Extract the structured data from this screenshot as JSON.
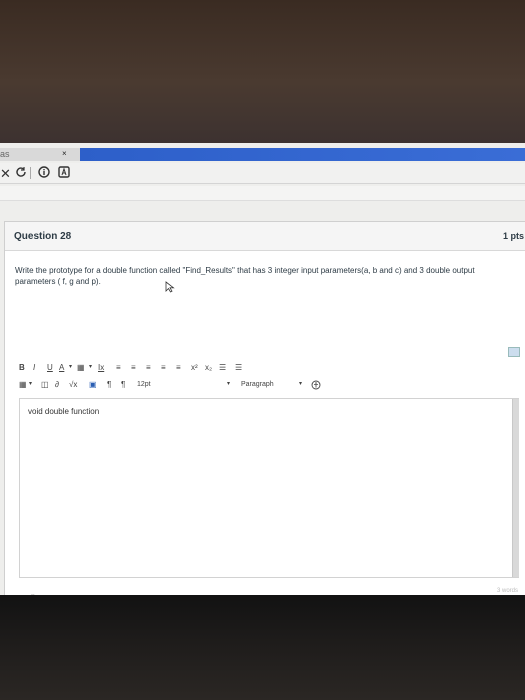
{
  "browser": {
    "tab_title": "as",
    "tab_close": "×",
    "toolbar_icons": [
      "close-icon",
      "refresh-icon",
      "info-icon",
      "extension-icon"
    ]
  },
  "question": {
    "title": "Question 28",
    "points": "1 pts",
    "prompt": "Write the prototype for a double function called \"Find_Results\" that has 3 integer input parameters(a, b and c) and 3 double output parameters ( f, g and p)."
  },
  "rte": {
    "row1": [
      "B",
      "I",
      "U",
      "A",
      "▾",
      "▦",
      "▾",
      "Ix",
      "≡",
      "≡",
      "≡",
      "≡",
      "≡",
      "x²",
      "x₂",
      "☰",
      "☰"
    ],
    "font_size": "12pt",
    "paragraph": "Paragraph",
    "row2_left": [
      "▦",
      "▾",
      "◫",
      "∂",
      "√x",
      "▣",
      "¶",
      "¶"
    ]
  },
  "answer": {
    "text": "void double function",
    "path": "p",
    "word_count": "3 words"
  }
}
